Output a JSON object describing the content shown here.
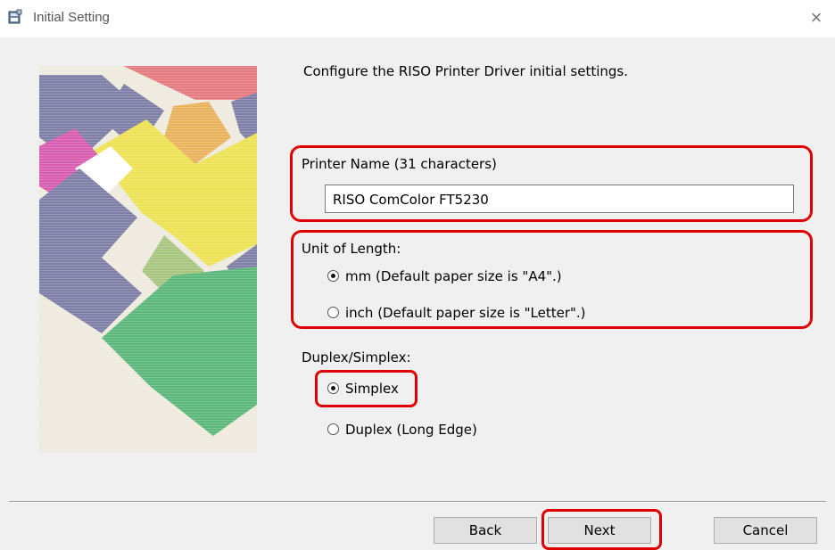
{
  "window": {
    "title": "Initial Setting",
    "close_symbol": "×",
    "icon": "printer-setup-icon"
  },
  "intro": "Configure the RISO Printer Driver initial settings.",
  "printer_name": {
    "label": "Printer Name (31 characters)",
    "value": "RISO ComColor FT5230"
  },
  "unit_of_length": {
    "label": "Unit of Length:",
    "options": [
      {
        "label": "mm (Default paper size is \"A4\".)",
        "selected": true
      },
      {
        "label": "inch (Default paper size is \"Letter\".)",
        "selected": false
      }
    ]
  },
  "duplex_simplex": {
    "label": "Duplex/Simplex:",
    "options": [
      {
        "label": "Simplex",
        "selected": true
      },
      {
        "label": "Duplex (Long Edge)",
        "selected": false
      }
    ]
  },
  "buttons": {
    "back": "Back",
    "next": "Next",
    "cancel": "Cancel"
  },
  "colors": {
    "highlight": "#e00000",
    "background": "#f0f0f0",
    "button_face": "#e1e1e1"
  }
}
